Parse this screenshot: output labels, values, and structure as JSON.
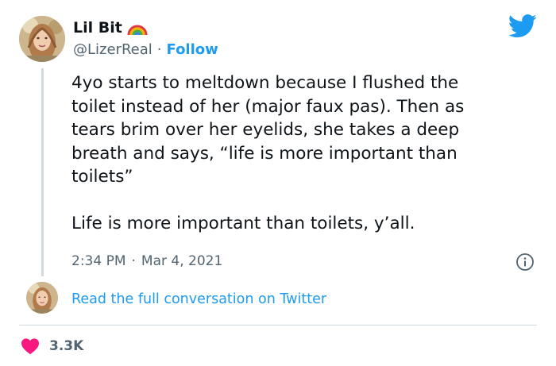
{
  "author": {
    "display_name": "Lil Bit",
    "handle": "@LizerReal",
    "separator": "·",
    "follow_label": "Follow",
    "name_emoji_icon": "rainbow-icon"
  },
  "brand_icon": "twitter-bird-icon",
  "tweet": {
    "text": "4yo starts to meltdown because I flushed the\ntoilet instead of her (major faux pas). Then as\ntears brim over her eyelids, she takes a deep\nbreath and says, “life is more important than\ntoilets”\n\nLife is more important than toilets, y’all.",
    "time": "2:34 PM",
    "separator": "·",
    "date": "Mar 4, 2021"
  },
  "conversation_link": "Read the full conversation on Twitter",
  "likes": {
    "count": "3.3K",
    "icon": "heart-icon"
  },
  "colors": {
    "accent_blue": "#1d9bf0",
    "heart_red": "#f91880",
    "secondary_text": "#536471",
    "primary_text": "#0f1419",
    "divider": "#cfd9de"
  }
}
